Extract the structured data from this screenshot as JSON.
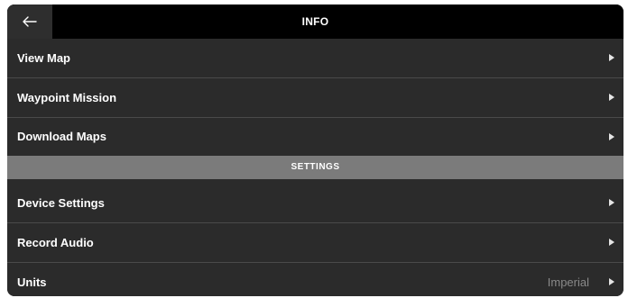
{
  "header": {
    "title": "INFO",
    "back_icon": "arrow-left-icon"
  },
  "menu_items": [
    {
      "label": "View Map",
      "icon": "chevron-right-icon"
    },
    {
      "label": "Waypoint Mission",
      "icon": "chevron-right-icon"
    },
    {
      "label": "Download Maps",
      "icon": "chevron-right-icon"
    }
  ],
  "settings_section": {
    "title": "SETTINGS",
    "items": [
      {
        "label": "Device Settings",
        "icon": "chevron-right-icon"
      },
      {
        "label": "Record Audio",
        "icon": "chevron-right-icon"
      },
      {
        "label": "Units",
        "value": "Imperial",
        "icon": "chevron-right-icon"
      }
    ]
  },
  "colors": {
    "background": "#2b2b2b",
    "topbar": "#000000",
    "section_header": "#7b7b7b",
    "text": "#ffffff",
    "value_text": "#8a8a8a"
  }
}
